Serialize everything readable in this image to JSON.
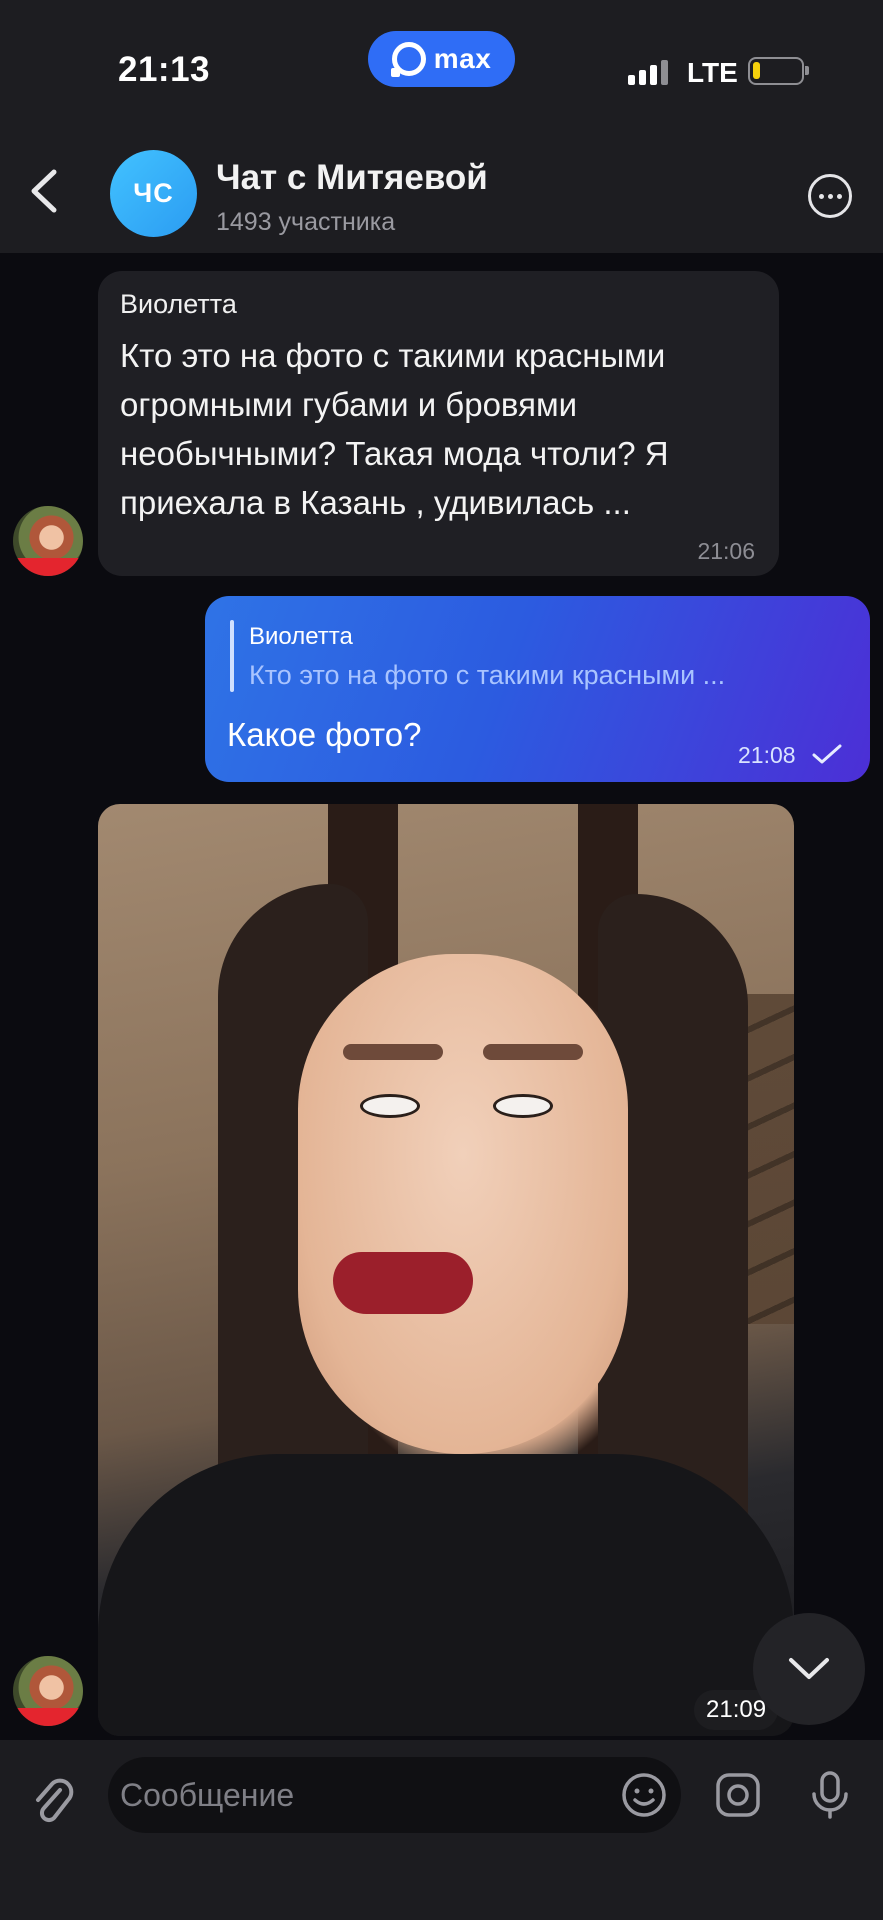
{
  "status_bar": {
    "time": "21:13",
    "app_badge": "max",
    "network": "LTE",
    "battery_level": 0.15
  },
  "header": {
    "back_icon": "chevron-left-icon",
    "avatar_initials": "ЧС",
    "title": "Чат с Митяевой",
    "subtitle": "1493 участника",
    "more_icon": "more-icon"
  },
  "messages": [
    {
      "direction": "incoming",
      "sender": "Виолетта",
      "text": "Кто это на фото с такими красными огромными губами и бровями необычными? Такая мода чтоли? Я приехала в Казань , удивилась ...",
      "time": "21:06"
    },
    {
      "direction": "outgoing",
      "reply_to_name": "Виолетта",
      "reply_to_text": "Кто это на фото с такими красными ...",
      "text": "Какое фото?",
      "time": "21:08",
      "status": "sent"
    },
    {
      "direction": "incoming",
      "type": "photo",
      "time": "21:09"
    }
  ],
  "composer": {
    "placeholder": "Сообщение"
  },
  "colors": {
    "background": "#0b0b10",
    "bar": "#1d1d21",
    "incoming_bubble": "#1f1f24",
    "outgoing_start": "#2f73e6",
    "outgoing_end": "#4c2fd6",
    "accent": "#2f6df6"
  }
}
